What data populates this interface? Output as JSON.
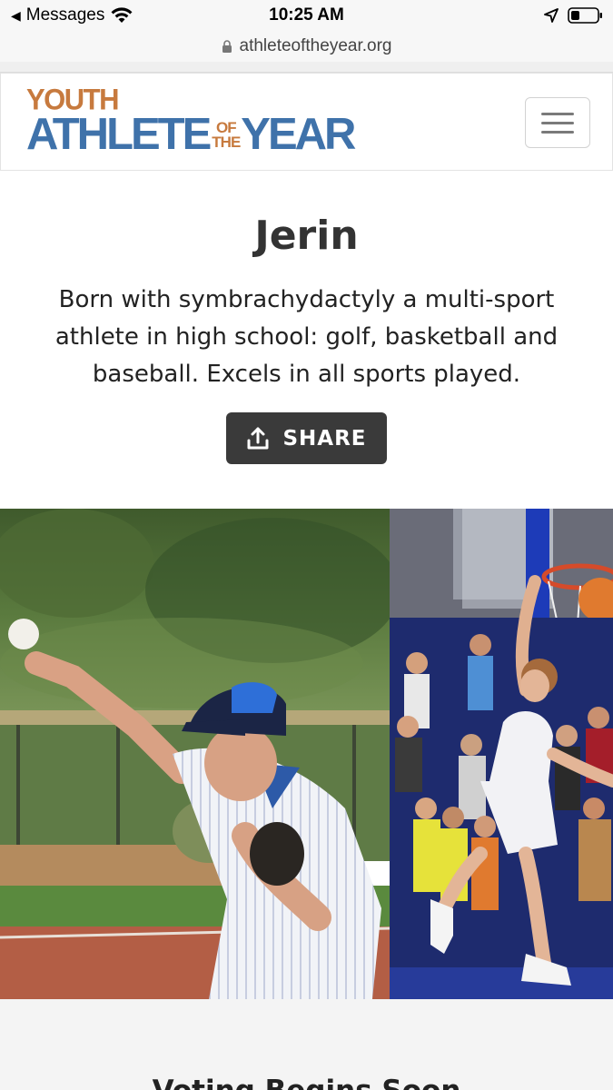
{
  "status_bar": {
    "back_app": "Messages",
    "time": "10:25 AM"
  },
  "browser": {
    "url": "athleteoftheyear.org"
  },
  "header": {
    "logo_youth": "YOUTH",
    "logo_athlete": "ATHLETE",
    "logo_of": "OF",
    "logo_the": "THE",
    "logo_year": "YEAR"
  },
  "athlete": {
    "name": "Jerin",
    "bio": "Born with symbrachydactyly a multi-sport athlete in high school: golf, basketball and baseball. Excels in all sports played.",
    "share_label": "SHARE"
  },
  "photos": {
    "left_icon": "baseball-pitcher-photo",
    "right_icon": "basketball-dunk-photo"
  },
  "section": {
    "voting_title": "Voting Begins Soon"
  },
  "colors": {
    "logo_orange": "#c77a3e",
    "logo_blue": "#3f72aa",
    "share_button": "#3a3a3a"
  }
}
